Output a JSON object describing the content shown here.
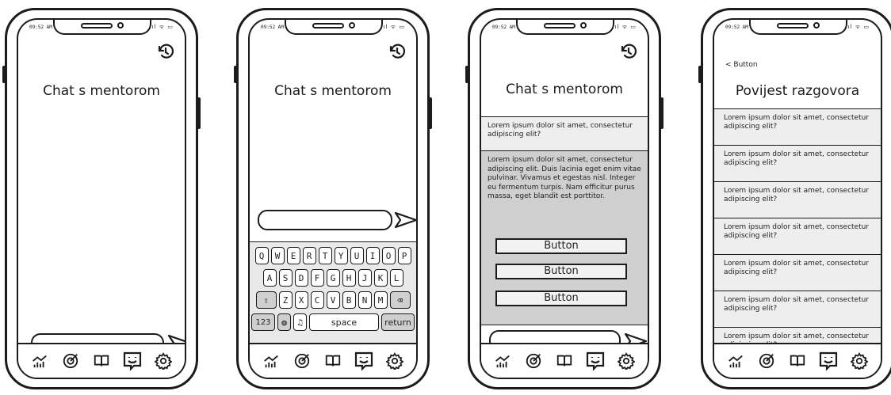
{
  "status": {
    "time": "09:52 AM",
    "icons": ".ıl ᯤ ▭"
  },
  "screens": [
    {
      "title": "Chat s mentorom"
    },
    {
      "title": "Chat s mentorom"
    },
    {
      "title": "Chat s mentorom"
    },
    {
      "title": "Povijest razgovora",
      "back_label": "< Button"
    }
  ],
  "keyboard": {
    "row1": [
      "Q",
      "W",
      "E",
      "R",
      "T",
      "Y",
      "U",
      "I",
      "O",
      "P"
    ],
    "row2": [
      "A",
      "S",
      "D",
      "F",
      "G",
      "H",
      "J",
      "K",
      "L"
    ],
    "row3": [
      "Z",
      "X",
      "C",
      "V",
      "B",
      "N",
      "M"
    ],
    "num_label": "123",
    "space_label": "space",
    "return_label": "return"
  },
  "chat": {
    "question": "Lorem ipsum dolor sit amet, consectetur adipiscing elit?",
    "answer": "Lorem ipsum dolor sit amet, consectetur adipiscing elit. Duis lacinia eget enim vitae pulvinar. Vivamus et egestas nisl. Integer eu fermentum turpis. Nam efficitur purus massa, eget blandit est porttitor.",
    "option_buttons": [
      "Button",
      "Button",
      "Button"
    ]
  },
  "history": {
    "items": [
      "Lorem ipsum dolor sit amet, consectetur adipiscing elit?",
      "Lorem ipsum dolor sit amet, consectetur adipiscing elit?",
      "Lorem ipsum dolor sit amet, consectetur adipiscing elit?",
      "Lorem ipsum dolor sit amet, consectetur adipiscing elit?",
      "Lorem ipsum dolor sit amet, consectetur adipiscing elit?",
      "Lorem ipsum dolor sit amet, consectetur adipiscing elit?",
      "Lorem ipsum dolor sit amet, consectetur adipiscing elit?"
    ]
  },
  "tabbar": {
    "icons": [
      "stats-icon",
      "target-icon",
      "book-icon",
      "chat-icon",
      "settings-icon"
    ]
  }
}
